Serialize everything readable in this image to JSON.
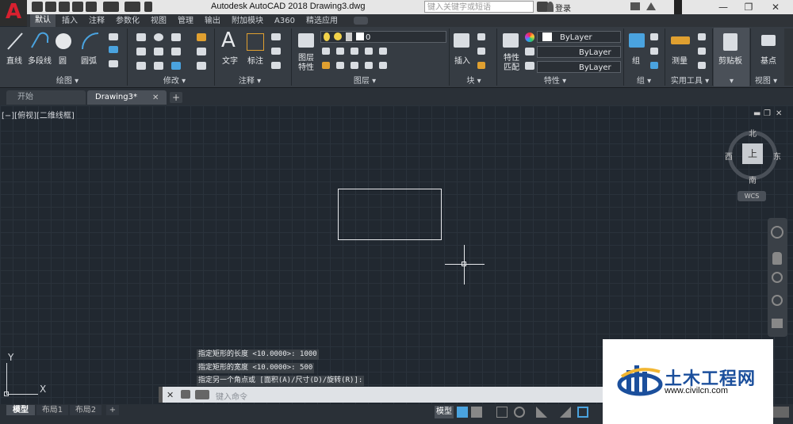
{
  "app": {
    "title": "Autodesk AutoCAD 2018    Drawing3.dwg",
    "search_placeholder": "键入关键字或短语",
    "login": "登录",
    "logo": "A"
  },
  "menu_tabs": [
    "默认",
    "插入",
    "注释",
    "参数化",
    "视图",
    "管理",
    "输出",
    "附加模块",
    "A360",
    "精选应用"
  ],
  "ribbon": {
    "draw_tools": [
      "直线",
      "多段线",
      "圆",
      "圆弧"
    ],
    "modify_tools": [],
    "annotation_tools": [
      "文字",
      "标注"
    ],
    "layer_tools": [
      "图层\n特性"
    ],
    "layer_current": "0",
    "block_tools": [
      "插入"
    ],
    "properties_tools": [
      "特性\n匹配"
    ],
    "bylayer": [
      "ByLayer",
      "ByLayer",
      "ByLayer"
    ],
    "group_tools": [
      "组"
    ],
    "utility_tools": [
      "测量"
    ],
    "clipboard_tools": [
      "剪贴板"
    ],
    "basepoint_tools": [
      "基点"
    ],
    "panels": [
      "绘图 ▾",
      "修改 ▾",
      "注释 ▾",
      "图层 ▾",
      "块 ▾",
      "特性 ▾",
      "组 ▾",
      "实用工具 ▾",
      "剪贴板",
      "视图 ▾"
    ]
  },
  "doc_tabs": [
    "开始",
    "Drawing3*"
  ],
  "viewport_label": "[−][俯视][二维线框]",
  "viewcube": {
    "north": "北",
    "south": "南",
    "east": "东",
    "west": "西",
    "top": "上",
    "wcs": "WCS"
  },
  "ucs": {
    "x": "X",
    "y": "Y"
  },
  "command_history": [
    "指定矩形的长度 <10.0000>: 1000",
    "指定矩形的宽度 <10.0000>: 500",
    "指定另一个角点或 [面积(A)/尺寸(D)/旋转(R)]:"
  ],
  "command_placeholder": "键入命令",
  "layout_tabs": [
    "模型",
    "布局1",
    "布局2"
  ],
  "status_model": "模型",
  "watermark": {
    "title": "土木工程网",
    "url": "www.civilcn.com"
  },
  "colors": {
    "accent_red": "#d8202f",
    "canvas_bg": "#212830",
    "ribbon_bg": "#363c43",
    "watermark_blue": "#1b4f9c"
  }
}
